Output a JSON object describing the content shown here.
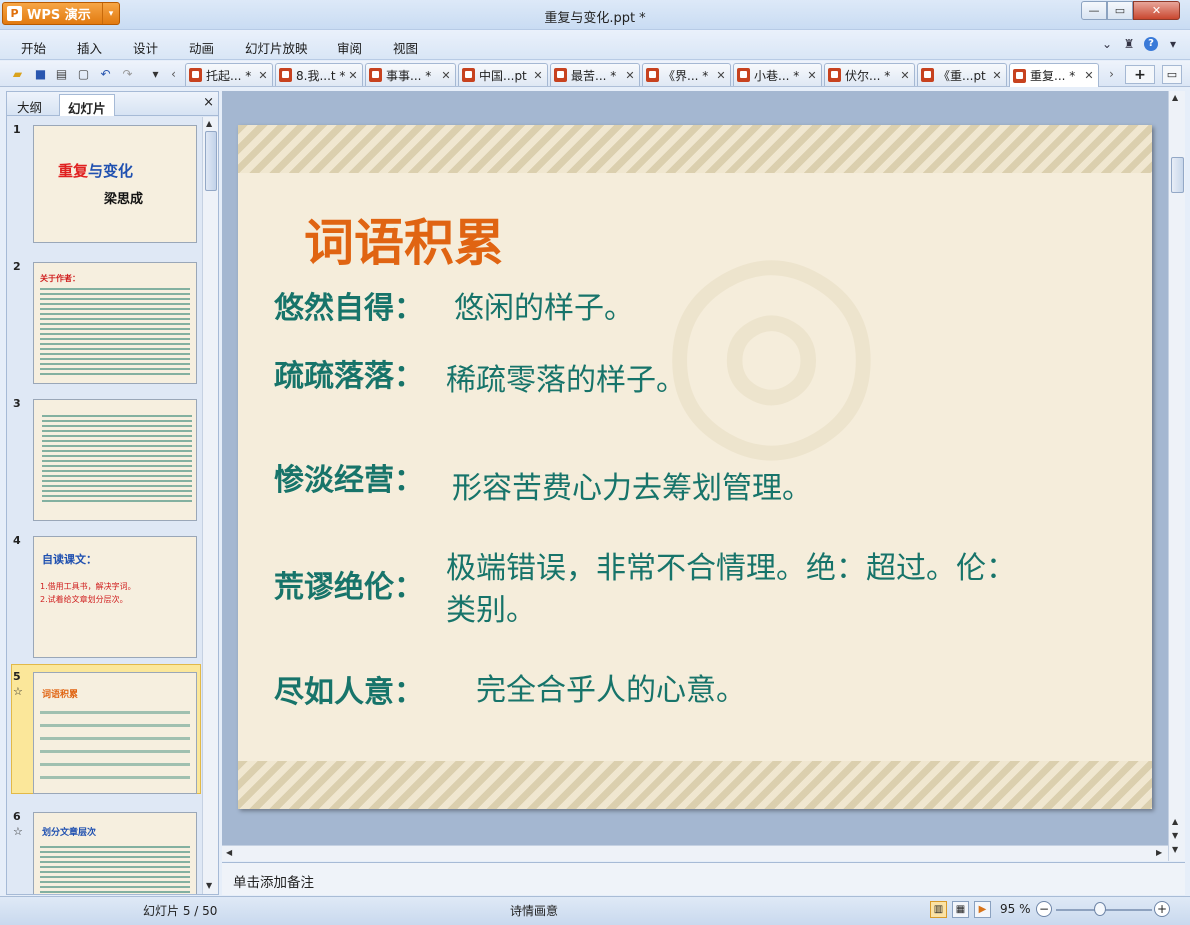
{
  "app": {
    "name": "WPS 演示",
    "window_title": "重复与变化.ppt *"
  },
  "menu": [
    "开始",
    "插入",
    "设计",
    "动画",
    "幻灯片放映",
    "审阅",
    "视图"
  ],
  "tabs": [
    {
      "label": "托起... *",
      "active": false
    },
    {
      "label": "8.我...t *",
      "active": false
    },
    {
      "label": "事事... *",
      "active": false
    },
    {
      "label": "中国...pt",
      "active": false
    },
    {
      "label": "最苦... *",
      "active": false
    },
    {
      "label": "《界... *",
      "active": false
    },
    {
      "label": "小巷... *",
      "active": false
    },
    {
      "label": "伏尔... *",
      "active": false
    },
    {
      "label": "《重...pt",
      "active": false
    },
    {
      "label": "重复... *",
      "active": true
    }
  ],
  "panel": {
    "tab_outline": "大纲",
    "tab_slides": "幻灯片",
    "close": "×"
  },
  "thumbnails": [
    {
      "num": "1",
      "title_red": "重复",
      "title_blue": "与变化",
      "subtitle": "梁思成"
    },
    {
      "num": "2",
      "heading": "关于作者："
    },
    {
      "num": "3"
    },
    {
      "num": "4",
      "heading": "自读课文：",
      "line1": "1.借用工具书，解决字词。",
      "line2": "2.试着给文章划分层次。"
    },
    {
      "num": "5",
      "heading": "词语积累",
      "selected": true
    },
    {
      "num": "6",
      "heading": "划分文章层次"
    }
  ],
  "slide": {
    "title": "词语积累",
    "entries": [
      {
        "term": "悠然自得：",
        "definition": "悠闲的样子。"
      },
      {
        "term": "疏疏落落：",
        "definition": "稀疏零落的样子。"
      },
      {
        "term": "惨淡经营：",
        "definition": "形容苦费心力去筹划管理。"
      },
      {
        "term": "荒谬绝伦：",
        "definition": "极端错误，非常不合情理。绝：超过。伦：",
        "definition2": "类别。"
      },
      {
        "term": "尽如人意：",
        "definition": "完全合乎人的心意。"
      }
    ]
  },
  "notes_placeholder": "单击添加备注",
  "status": {
    "slide_counter": "幻灯片 5 / 50",
    "theme": "诗情画意",
    "zoom": "95 %"
  },
  "colors": {
    "title_orange": "#e06412",
    "text_teal": "#17746a",
    "slide_bg": "#f5eddb",
    "accent_orange": "#e27a10"
  }
}
